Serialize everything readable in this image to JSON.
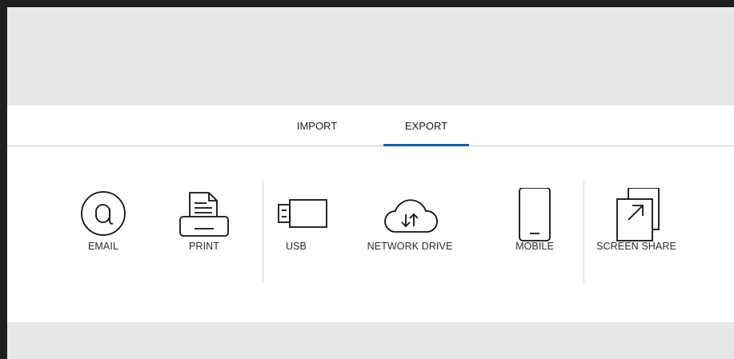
{
  "tabs": {
    "import_label": "IMPORT",
    "export_label": "EXPORT",
    "active": "EXPORT"
  },
  "export_items": [
    {
      "label": "EMAIL",
      "icon": "at-sign-icon"
    },
    {
      "label": "PRINT",
      "icon": "printer-icon"
    },
    {
      "label": "USB",
      "icon": "usb-drive-icon"
    },
    {
      "label": "NETWORK DRIVE",
      "icon": "cloud-transfer-icon"
    },
    {
      "label": "MOBILE",
      "icon": "mobile-phone-icon"
    },
    {
      "label": "SCREEN SHARE",
      "icon": "screen-share-icon"
    }
  ],
  "colors": {
    "accent": "#1d5fa8",
    "background": "#e6e7e9",
    "panel": "#ffffff",
    "frame": "#1f1f1f"
  }
}
